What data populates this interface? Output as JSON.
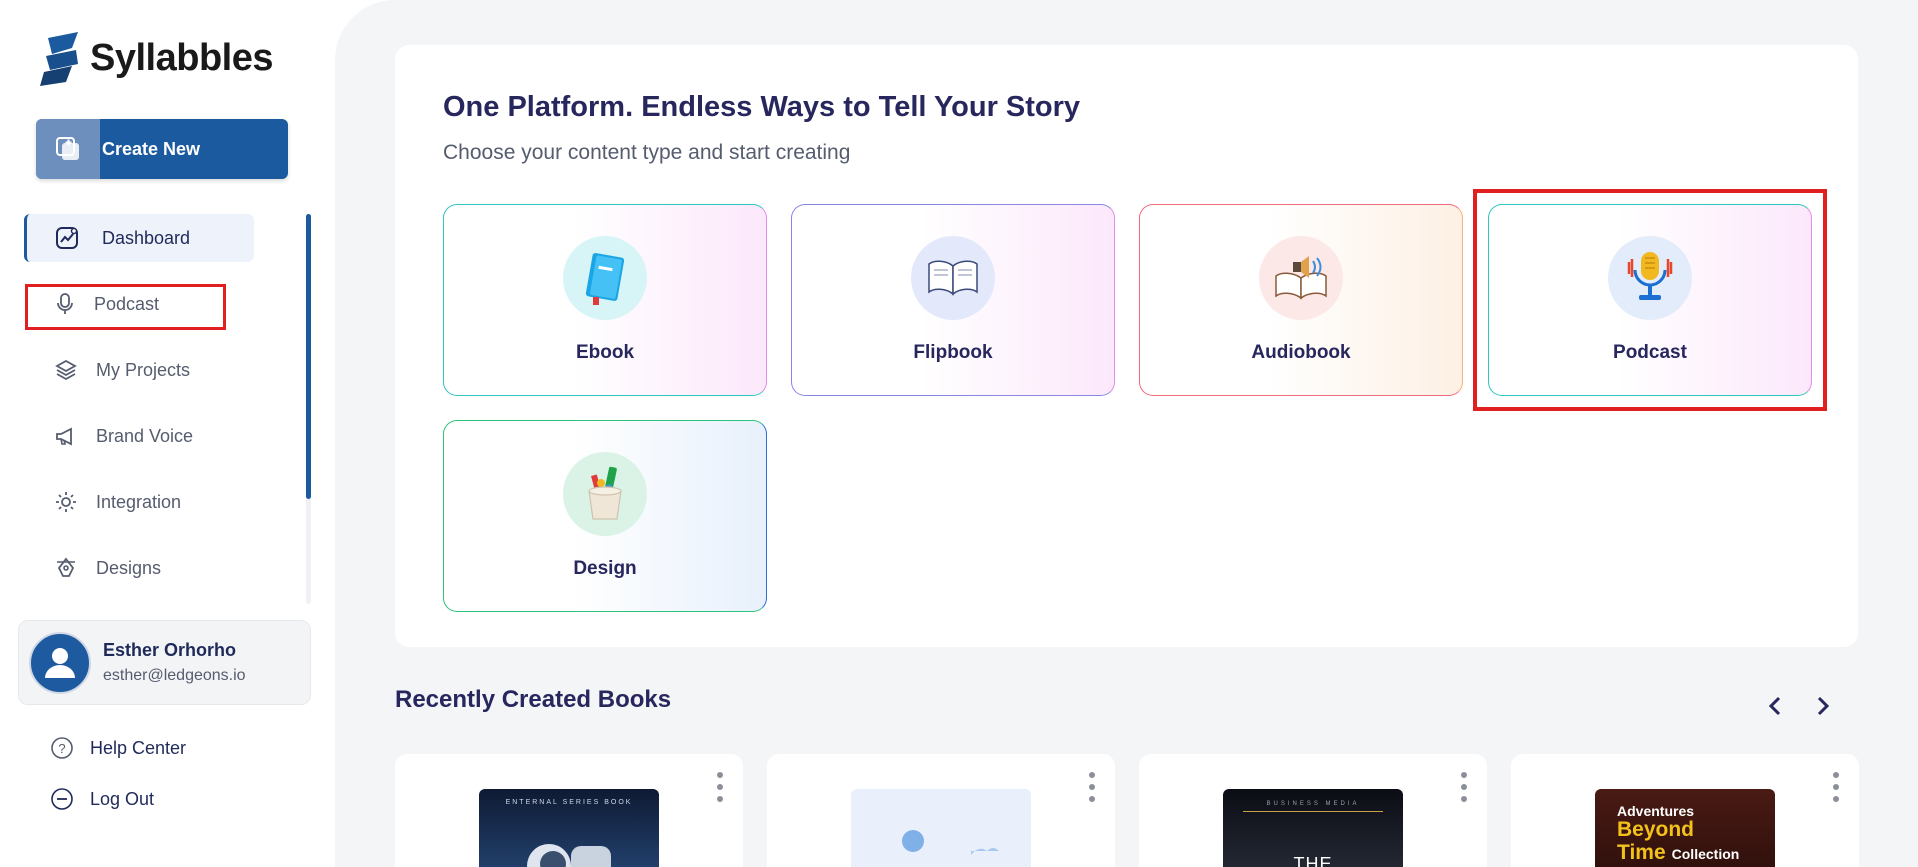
{
  "brand": {
    "name": "Syllabbles"
  },
  "sidebar": {
    "create_label": "Create New",
    "items": [
      {
        "label": "Dashboard",
        "icon": "dashboard-chart-icon",
        "active": true
      },
      {
        "label": "Podcast",
        "icon": "microphone-icon"
      },
      {
        "label": "My Projects",
        "icon": "layers-icon"
      },
      {
        "label": "Brand Voice",
        "icon": "megaphone-icon"
      },
      {
        "label": "Integration",
        "icon": "gear-integration-icon"
      },
      {
        "label": "Designs",
        "icon": "pen-tool-icon"
      }
    ],
    "colors": {
      "accent": "#1c5aa0",
      "highlight": "#e02020"
    }
  },
  "profile": {
    "name": "Esther Orhorho",
    "email": "esther@ledgeons.io"
  },
  "footer": {
    "help": "Help Center",
    "logout": "Log Out"
  },
  "hero": {
    "title": "One Platform. Endless Ways to Tell Your Story",
    "subtitle": "Choose your content type and start creating",
    "cards": [
      {
        "label": "Ebook",
        "icon": "blue-book-icon"
      },
      {
        "label": "Flipbook",
        "icon": "open-book-icon"
      },
      {
        "label": "Audiobook",
        "icon": "speaker-book-icon"
      },
      {
        "label": "Podcast",
        "icon": "podcast-microphone-icon"
      },
      {
        "label": "Design",
        "icon": "paint-pot-icon"
      }
    ]
  },
  "recent": {
    "title": "Recently Created Books",
    "books": [
      {
        "cover_text": "ENTERNAL SERIES BOOK"
      },
      {
        "cover_text": ""
      },
      {
        "cover_text_top": "BUSINESS MEDIA",
        "cover_text_main": "THE"
      },
      {
        "cover_line1": "Adventures",
        "cover_line2": "Beyond",
        "cover_line3": "Time",
        "cover_line4": "Collection"
      }
    ]
  }
}
